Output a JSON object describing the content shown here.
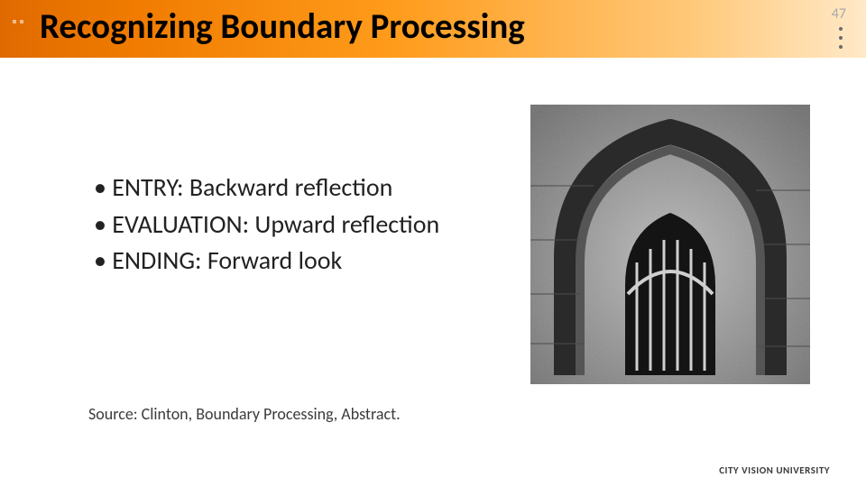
{
  "title": "Recognizing Boundary Processing",
  "page_number": "47",
  "bullets": [
    "ENTRY: Backward reflection",
    "EVALUATION: Upward reflection",
    "ENDING: Forward look"
  ],
  "source": "Source: Clinton, Boundary Processing, Abstract.",
  "footer": "CITY VISION UNIVERSITY",
  "image_alt": "stone-archway-photo",
  "colors": {
    "title_gradient_from": "#e06a00",
    "title_gradient_to": "#ffe9c8"
  }
}
